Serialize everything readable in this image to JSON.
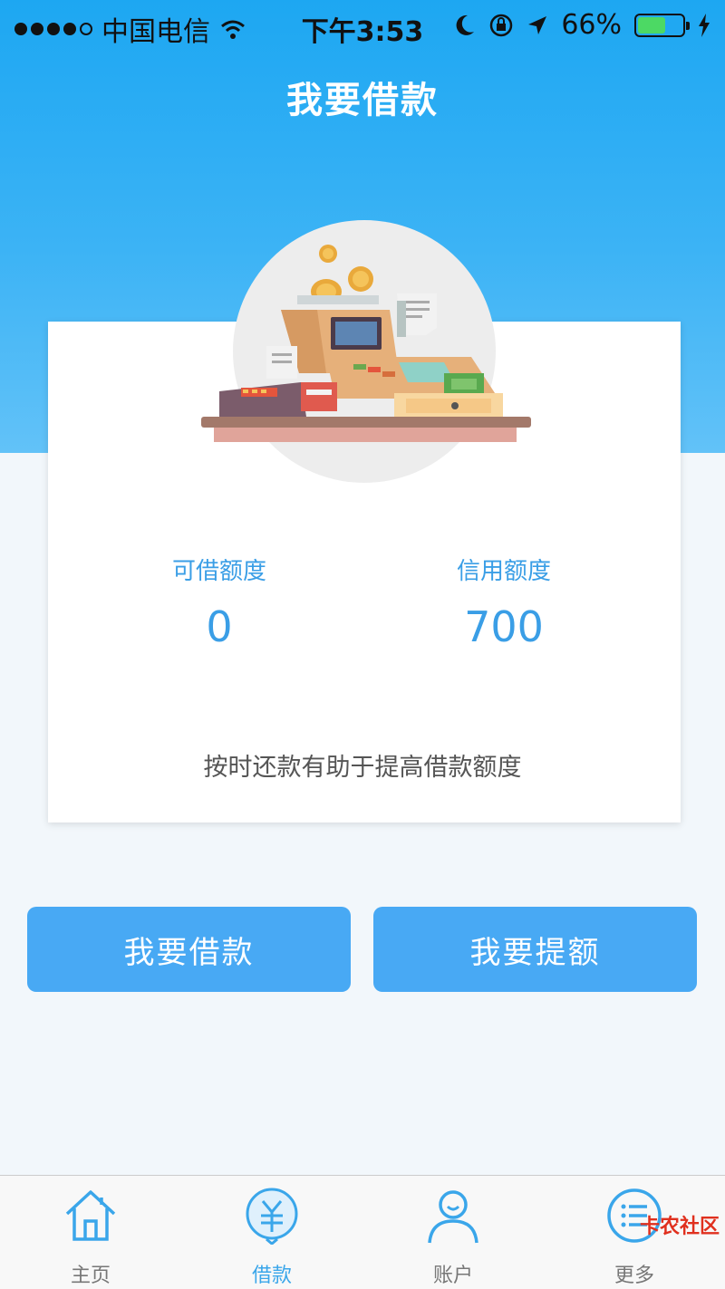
{
  "status_bar": {
    "carrier": "中国电信",
    "time": "下午3:53",
    "battery_percent": "66%",
    "battery_level": 0.66,
    "icons": [
      "wifi-icon",
      "moon-icon",
      "rotation-lock-icon",
      "location-arrow-icon",
      "battery-icon",
      "charging-icon"
    ]
  },
  "header": {
    "title": "我要借款"
  },
  "card": {
    "illustration": "cash-register-illustration",
    "available_label": "可借额度",
    "available_value": "0",
    "credit_label": "信用额度",
    "credit_value": "700",
    "hint": "按时还款有助于提高借款额度"
  },
  "actions": {
    "borrow_label": "我要借款",
    "raise_label": "我要提额"
  },
  "tabbar": {
    "items": [
      {
        "label": "主页",
        "icon": "home-icon",
        "active": false
      },
      {
        "label": "借款",
        "icon": "yuan-icon",
        "active": true
      },
      {
        "label": "账户",
        "icon": "user-icon",
        "active": false
      },
      {
        "label": "更多",
        "icon": "more-icon",
        "active": false
      }
    ]
  },
  "watermark": {
    "text": "卡农社区"
  },
  "colors": {
    "primary": "#48a9f4",
    "header": "#1da7f2",
    "text_accent": "#3a9ee6"
  }
}
